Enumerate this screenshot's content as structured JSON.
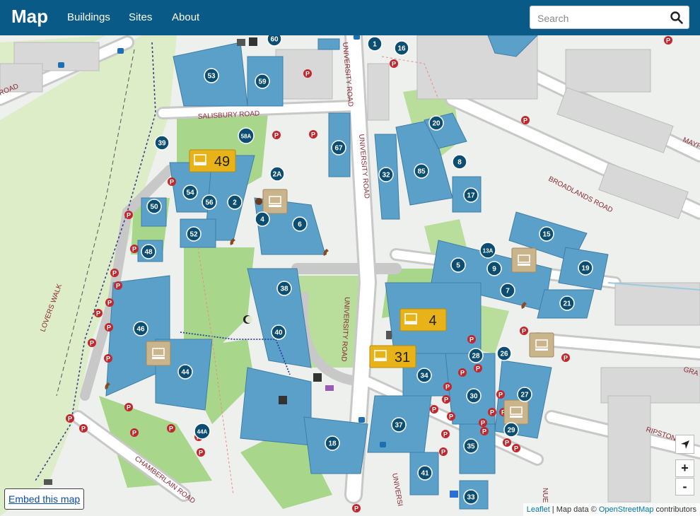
{
  "nav": {
    "brand": "Map",
    "links": [
      "Buildings",
      "Sites",
      "About"
    ],
    "search_placeholder": "Search"
  },
  "roads": [
    "SALISBURY ROAD",
    "UNIVERSITY ROAD",
    "UNIVERSITY ROAD",
    "UNIVERSITY ROAD",
    "BROADLANDS ROAD",
    "CHAMBERLAIN ROAD",
    "LOVERS WALK",
    "RIPSTONE",
    "GRA",
    "MAYF",
    "ROAD",
    "UNIVERSI",
    "NUE"
  ],
  "buildings": [
    "60",
    "1",
    "16",
    "53",
    "59",
    "58A",
    "67",
    "20",
    "39",
    "2A",
    "32",
    "85",
    "8",
    "17",
    "54",
    "56",
    "2",
    "50",
    "4",
    "6",
    "52",
    "48",
    "15",
    "13A",
    "5",
    "9",
    "19",
    "7",
    "38",
    "21",
    "46",
    "40",
    "28",
    "26",
    "44",
    "34",
    "30",
    "27",
    "37",
    "29",
    "44A",
    "35",
    "18",
    "41",
    "33"
  ],
  "computer_counts": [
    "49",
    "4",
    "31"
  ],
  "zoom": {
    "in": "+",
    "out": "-"
  },
  "attribution": {
    "leaflet": "Leaflet",
    "mid": " | Map data © ",
    "osm": "OpenStreetMap",
    "tail": " contributors"
  },
  "embed_label": "Embed this map",
  "colors": {
    "navbar": "#0a5a87",
    "building": "#5ba0c9",
    "marker": "#0c4d72",
    "parking": "#c0282e",
    "computer_badge": "#e7b318"
  }
}
